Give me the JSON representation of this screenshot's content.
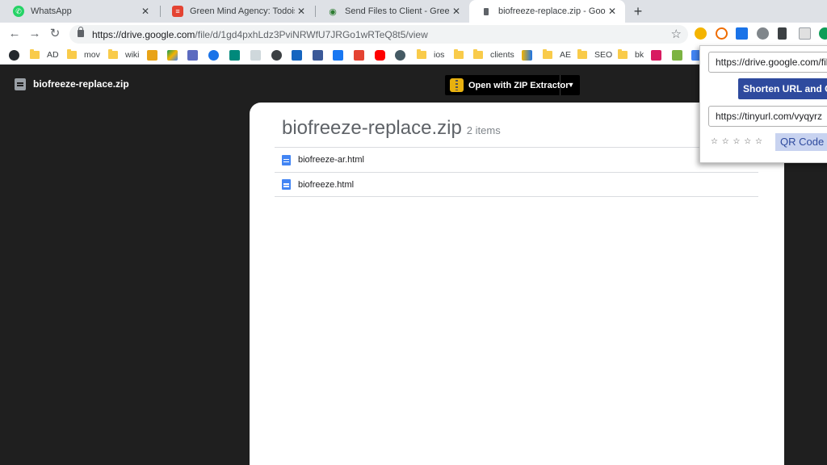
{
  "tabs": [
    {
      "label": "WhatsApp",
      "icon": "whatsapp-icon",
      "color": "#25d366"
    },
    {
      "label": "Green Mind Agency: Todoist",
      "icon": "todoist-icon",
      "color": "#e44332"
    },
    {
      "label": "Send Files to Client - Green Mind",
      "icon": "eye-icon",
      "color": "#2e7d32"
    },
    {
      "label": "biofreeze-replace.zip - Google Dr",
      "icon": "drive-file-icon",
      "color": "#5f6368"
    }
  ],
  "toolbar": {
    "url_host": "https://drive.google.com",
    "url_path": "/file/d/1gd4pxhLdz3PviNRWfU7JRGo1wRTeQ8t5/view"
  },
  "bookmarks": [
    {
      "label": "AD",
      "type": "folder"
    },
    {
      "label": "mov",
      "type": "folder"
    },
    {
      "label": "wiki",
      "type": "folder"
    },
    {
      "label": "ios",
      "type": "folder"
    },
    {
      "label": "clients",
      "type": "folder"
    },
    {
      "label": "AE",
      "type": "folder"
    },
    {
      "label": "SEO",
      "type": "folder"
    },
    {
      "label": "bk",
      "type": "folder"
    }
  ],
  "viewer": {
    "file_title": "biofreeze-replace.zip",
    "open_with_label": "Open with ZIP Extractor",
    "zip_title": "biofreeze-replace.zip",
    "item_count": "2 items",
    "items": [
      {
        "name": "biofreeze-ar.html"
      },
      {
        "name": "biofreeze.html"
      }
    ]
  },
  "popup": {
    "long_url": "https://drive.google.com/file/d/",
    "shorten_label": "Shorten URL and Copy",
    "short_url": "https://tinyurl.com/vyqyrz",
    "rating": "☆ ☆ ☆ ☆ ☆",
    "qr_label": "QR Code"
  },
  "colors": {
    "viewer_bg": "#1f1f1f",
    "accent_blue": "#2e4a9e",
    "file_blue": "#4285f4"
  }
}
